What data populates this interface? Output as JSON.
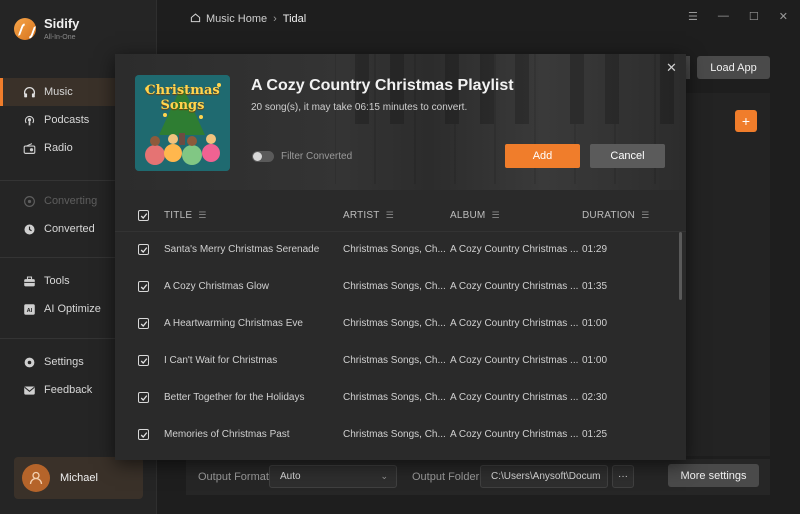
{
  "app": {
    "name": "Sidify",
    "subtitle": "All-In-One"
  },
  "sidebar": {
    "items": [
      {
        "label": "Music",
        "icon": "headphones-icon",
        "active": true
      },
      {
        "label": "Podcasts",
        "icon": "podcast-icon"
      },
      {
        "label": "Radio",
        "icon": "radio-icon"
      },
      {
        "label": "Converting",
        "icon": "converting-icon",
        "disabled": true
      },
      {
        "label": "Converted",
        "icon": "clock-icon"
      },
      {
        "label": "Tools",
        "icon": "toolbox-icon"
      },
      {
        "label": "AI Optimize",
        "icon": "ai-icon"
      },
      {
        "label": "Settings",
        "icon": "gear-icon"
      },
      {
        "label": "Feedback",
        "icon": "mail-icon"
      }
    ],
    "user": {
      "name": "Michael"
    }
  },
  "breadcrumb": {
    "home": "Music Home",
    "current": "Tidal"
  },
  "main": {
    "load_app": "Load App",
    "output_format_label": "Output Format",
    "output_format_value": "Auto",
    "output_folder_label": "Output Folder",
    "output_folder_value": "C:\\Users\\Anysoft\\Docum",
    "more_settings": "More settings",
    "folder_browse": "···"
  },
  "modal": {
    "title": "A Cozy Country Christmas Playlist",
    "subtitle": "20 song(s), it may take 06:15 minutes to convert.",
    "filter_label": "Filter Converted",
    "add": "Add",
    "cancel": "Cancel",
    "cover_text": "Christmas Songs",
    "columns": {
      "title": "TITLE",
      "artist": "ARTIST",
      "album": "ALBUM",
      "duration": "DURATION"
    },
    "rows": [
      {
        "title": "Santa's Merry Christmas Serenade",
        "artist": "Christmas Songs, Ch...",
        "album": "A Cozy Country Christmas ...",
        "duration": "01:29"
      },
      {
        "title": "A Cozy Christmas Glow",
        "artist": "Christmas Songs, Ch...",
        "album": "A Cozy Country Christmas ...",
        "duration": "01:35"
      },
      {
        "title": "A Heartwarming Christmas Eve",
        "artist": "Christmas Songs, Ch...",
        "album": "A Cozy Country Christmas ...",
        "duration": "01:00"
      },
      {
        "title": "I Can't Wait for Christmas",
        "artist": "Christmas Songs, Ch...",
        "album": "A Cozy Country Christmas ...",
        "duration": "01:00"
      },
      {
        "title": "Better Together for the Holidays",
        "artist": "Christmas Songs, Ch...",
        "album": "A Cozy Country Christmas ...",
        "duration": "02:30"
      },
      {
        "title": "Memories of Christmas Past",
        "artist": "Christmas Songs, Ch...",
        "album": "A Cozy Country Christmas ...",
        "duration": "01:25"
      }
    ]
  },
  "colors": {
    "accent": "#f07d2b",
    "bg": "#1e1e1e",
    "sidebar": "#252525",
    "modal": "#2a2a2a"
  }
}
